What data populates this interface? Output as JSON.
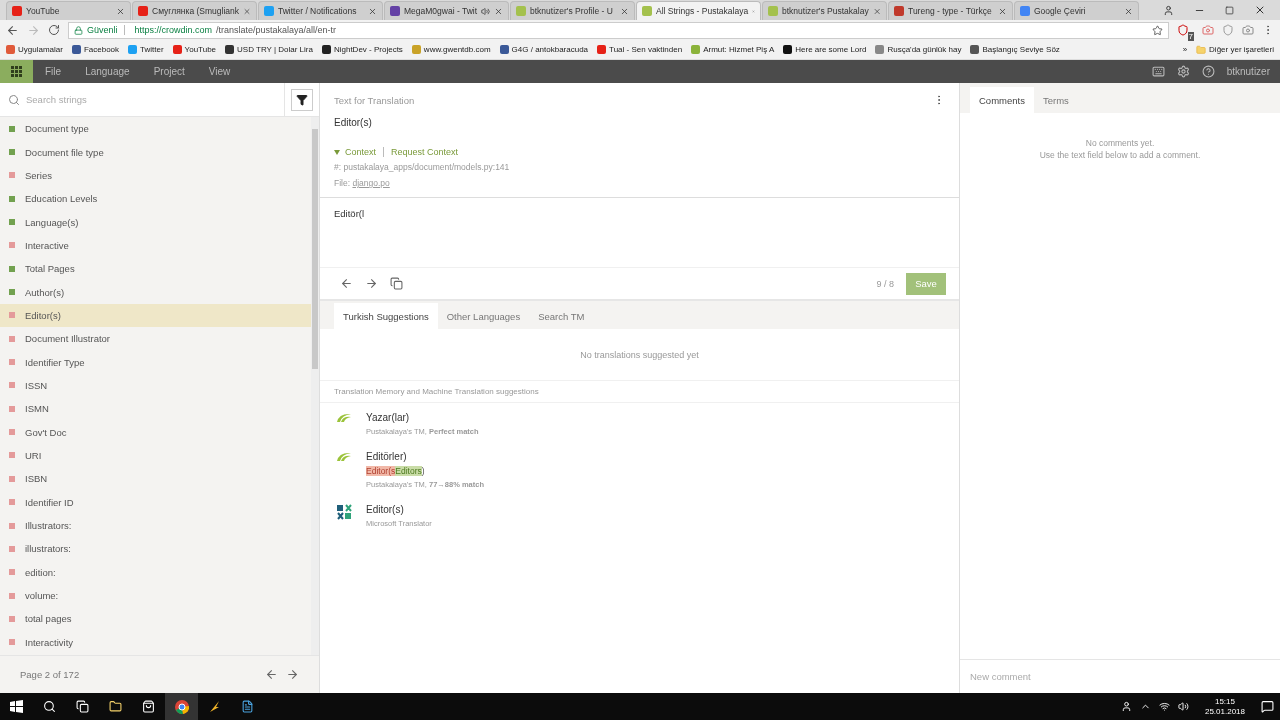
{
  "browser": {
    "tabs": [
      {
        "title": "YouTube",
        "color": "#e62117",
        "selected": false,
        "audio": false
      },
      {
        "title": "Смуглянка (Smugliank",
        "color": "#e62117",
        "selected": false,
        "audio": false
      },
      {
        "title": "Twitter / Notifications",
        "color": "#1da1f2",
        "selected": false,
        "audio": false
      },
      {
        "title": "MegaM0gwai - Twit",
        "color": "#6441a5",
        "selected": false,
        "audio": true
      },
      {
        "title": "btknutizer's Profile - U",
        "color": "#a4c14d",
        "selected": false,
        "audio": false
      },
      {
        "title": "All Strings - Pustakalaya",
        "color": "#a4c14d",
        "selected": true,
        "audio": false
      },
      {
        "title": "btknutizer's Pustakalay",
        "color": "#a4c14d",
        "selected": false,
        "audio": false
      },
      {
        "title": "Tureng - type - Türkçe",
        "color": "#c0392b",
        "selected": false,
        "audio": false
      },
      {
        "title": "Google Çeviri",
        "color": "#4285f4",
        "selected": false,
        "audio": false
      }
    ],
    "secure_label": "Güvenli",
    "url_host": "https://crowdin.com",
    "url_path": "/translate/pustakalaya/all/en-tr",
    "extension_badge": "7",
    "bookmarks": [
      {
        "label": "Uygulamalar",
        "color": "#e05a3a"
      },
      {
        "label": "Facebook",
        "color": "#3b5998"
      },
      {
        "label": "Twitter",
        "color": "#1da1f2"
      },
      {
        "label": "YouTube",
        "color": "#e62117"
      },
      {
        "label": "USD TRY | Dolar Lira",
        "color": "#333333"
      },
      {
        "label": "NightDev - Projects",
        "color": "#222222"
      },
      {
        "label": "www.gwentdb.com",
        "color": "#c9a227"
      },
      {
        "label": "G4G / antokbaracuda",
        "color": "#3b5998"
      },
      {
        "label": "Tual - Sen vaktinden",
        "color": "#e62117"
      },
      {
        "label": "Armut: Hizmet Piş A",
        "color": "#8bb33a"
      },
      {
        "label": "Here are some Lord",
        "color": "#111111"
      },
      {
        "label": "Rusça'da günlük hay",
        "color": "#888888"
      },
      {
        "label": "Başlangıç Seviye Söz",
        "color": "#555555"
      }
    ],
    "more_bookmarks": "»",
    "other_bookmarks": "Diğer yer işaretleri"
  },
  "menu": {
    "items": [
      "File",
      "Language",
      "Project",
      "View"
    ],
    "user": "btknutizer"
  },
  "strings_panel": {
    "search": {
      "placeholder": "Search strings"
    },
    "items": [
      {
        "text": "Document type",
        "translated": true,
        "selected": false
      },
      {
        "text": "Document file type",
        "translated": true,
        "selected": false
      },
      {
        "text": "Series",
        "translated": false,
        "selected": false
      },
      {
        "text": "Education Levels",
        "translated": true,
        "selected": false
      },
      {
        "text": "Language(s)",
        "translated": true,
        "selected": false
      },
      {
        "text": "Interactive",
        "translated": false,
        "selected": false
      },
      {
        "text": "Total Pages",
        "translated": true,
        "selected": false
      },
      {
        "text": "Author(s)",
        "translated": true,
        "selected": false
      },
      {
        "text": "Editor(s)",
        "translated": false,
        "selected": true
      },
      {
        "text": "Document Illustrator",
        "translated": false,
        "selected": false
      },
      {
        "text": "Identifier Type",
        "translated": false,
        "selected": false
      },
      {
        "text": "ISSN",
        "translated": false,
        "selected": false
      },
      {
        "text": "ISMN",
        "translated": false,
        "selected": false
      },
      {
        "text": "Gov't Doc",
        "translated": false,
        "selected": false
      },
      {
        "text": "URI",
        "translated": false,
        "selected": false
      },
      {
        "text": "ISBN",
        "translated": false,
        "selected": false
      },
      {
        "text": "Identifier ID",
        "translated": false,
        "selected": false
      },
      {
        "text": "Illustrators:",
        "translated": false,
        "selected": false
      },
      {
        "text": "illustrators:",
        "translated": false,
        "selected": false
      },
      {
        "text": "edition:",
        "translated": false,
        "selected": false
      },
      {
        "text": "volume:",
        "translated": false,
        "selected": false
      },
      {
        "text": "total pages",
        "translated": false,
        "selected": false
      },
      {
        "text": "Interactivity",
        "translated": false,
        "selected": false
      }
    ],
    "page_label": "Page 2 of 172"
  },
  "editor": {
    "heading": "Text for Translation",
    "source_text": "Editor(s)",
    "context_toggle": "Context",
    "request_context": "Request Context",
    "context_path": "#: pustakalaya_apps/document/models.py:141",
    "file_label": "File:",
    "file_name": "django.po",
    "translation_value": "Editör(l",
    "counter": "9 / 8",
    "save_button": "Save"
  },
  "suggestions": {
    "tabs": [
      {
        "label": "Turkish Suggestions",
        "selected": true
      },
      {
        "label": "Other Languages",
        "selected": false
      },
      {
        "label": "Search TM",
        "selected": false
      }
    ],
    "empty_message": "No translations suggested yet",
    "section_heading": "Translation Memory and Machine Translation suggestions",
    "items": [
      {
        "kind": "tm",
        "text": "Yazar(lar)",
        "source": "Pustakalaya's TM, **Perfect match**"
      },
      {
        "kind": "tm",
        "text": "Editörler)",
        "diff": [
          {
            "text": "Editor(s",
            "kind": "removed"
          },
          {
            "text": "Editors",
            "kind": "added"
          },
          {
            "text": ")",
            "kind": "same"
          }
        ],
        "source": "Pustakalaya's TM, **77→88% match**"
      },
      {
        "kind": "mt",
        "text": "Editor(s)",
        "source": "Microsoft Translator"
      }
    ]
  },
  "comments_panel": {
    "tabs": [
      {
        "label": "Comments",
        "selected": true
      },
      {
        "label": "Terms",
        "selected": false
      }
    ],
    "empty_lines": [
      "No comments yet.",
      "Use the text field below to add a comment."
    ],
    "new_comment": {
      "placeholder": "New comment"
    }
  },
  "taskbar": {
    "time": "15:15",
    "date": "25.01.2018"
  }
}
